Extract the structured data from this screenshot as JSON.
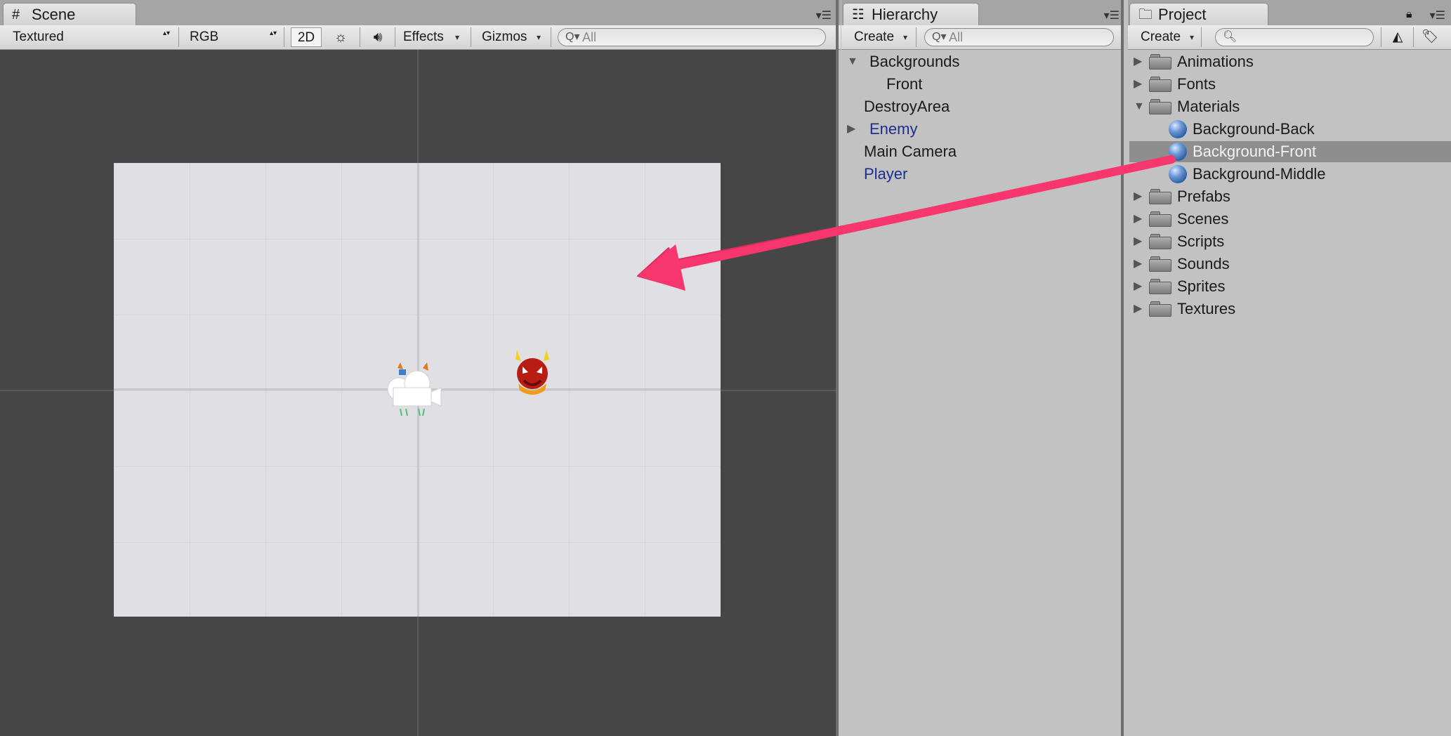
{
  "scene": {
    "tab_label": "Scene",
    "render_mode": "Textured",
    "color_mode": "RGB",
    "mode_2d": "2D",
    "effects_label": "Effects",
    "gizmos_label": "Gizmos",
    "search_placeholder": "All"
  },
  "hierarchy": {
    "tab_label": "Hierarchy",
    "create_label": "Create",
    "search_placeholder": "All",
    "items": [
      {
        "label": "Backgrounds",
        "expanded": true
      },
      {
        "label": "Front"
      },
      {
        "label": "DestroyArea"
      },
      {
        "label": "Enemy",
        "prefab": true,
        "collapsed": true
      },
      {
        "label": "Main Camera"
      },
      {
        "label": "Player",
        "prefab": true
      }
    ]
  },
  "project": {
    "tab_label": "Project",
    "create_label": "Create",
    "items": [
      {
        "label": "Animations",
        "type": "folder"
      },
      {
        "label": "Fonts",
        "type": "folder"
      },
      {
        "label": "Materials",
        "type": "folder",
        "expanded": true
      },
      {
        "label": "Background-Back",
        "type": "material"
      },
      {
        "label": "Background-Front",
        "type": "material",
        "selected": true
      },
      {
        "label": "Background-Middle",
        "type": "material"
      },
      {
        "label": "Prefabs",
        "type": "folder"
      },
      {
        "label": "Scenes",
        "type": "folder"
      },
      {
        "label": "Scripts",
        "type": "folder"
      },
      {
        "label": "Sounds",
        "type": "folder"
      },
      {
        "label": "Sprites",
        "type": "folder"
      },
      {
        "label": "Textures",
        "type": "folder"
      }
    ]
  },
  "colors": {
    "arrow": "#f7366e",
    "selection": "#8e8e8e",
    "prefab_text": "#1b2f8f"
  }
}
